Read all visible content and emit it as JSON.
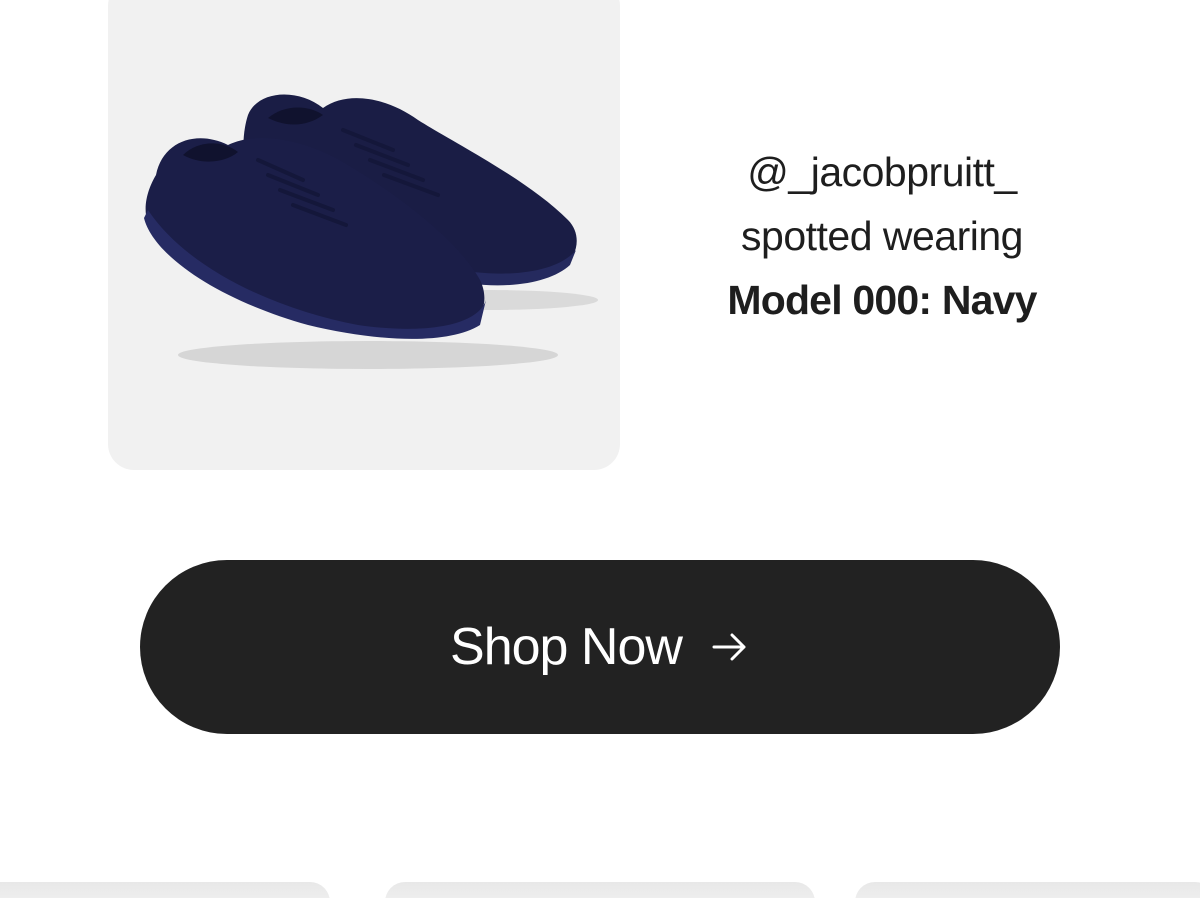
{
  "product": {
    "image_alt": "Model 000 navy sneakers",
    "color": "#1c1f4a"
  },
  "caption": {
    "handle": "@_jacobpruitt_",
    "action": "spotted wearing",
    "product_name": "Model 000: Navy"
  },
  "cta": {
    "label": "Shop Now",
    "icon": "arrow-right-icon",
    "background": "#222222"
  }
}
